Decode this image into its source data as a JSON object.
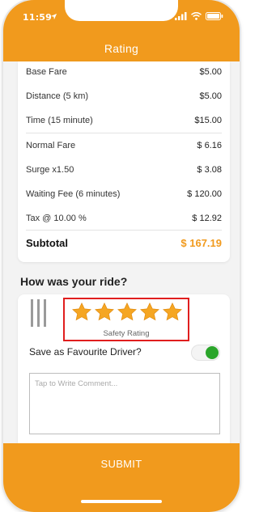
{
  "status_bar": {
    "time": "11:59"
  },
  "header": {
    "title": "Rating"
  },
  "fare": {
    "rows_a": [
      {
        "label": "Base Fare",
        "value": "$5.00"
      },
      {
        "label": "Distance (5 km)",
        "value": "$5.00"
      },
      {
        "label": "Time (15 minute)",
        "value": "$15.00"
      }
    ],
    "rows_b": [
      {
        "label": "Normal Fare",
        "value": "$ 6.16"
      },
      {
        "label": "Surge x1.50",
        "value": "$ 3.08"
      },
      {
        "label": "Waiting Fee (6 minutes)",
        "value": "$ 120.00"
      },
      {
        "label": "Tax @ 10.00 %",
        "value": "$ 12.92"
      }
    ],
    "subtotal": {
      "label": "Subtotal",
      "value": "$ 167.19"
    }
  },
  "rating": {
    "heading": "How was your ride?",
    "stars_filled": 5,
    "stars_total": 5,
    "star_color": "#f5a623",
    "safety_label": "Safety Rating",
    "favourite_label": "Save as Favourite Driver?",
    "favourite_enabled": true,
    "comment_placeholder": "Tap to Write Comment..."
  },
  "footer": {
    "submit_label": "SUBMIT"
  },
  "colors": {
    "accent": "#f19a1d",
    "toggle_on": "#2aa52a",
    "highlight": "#e01e1e"
  }
}
